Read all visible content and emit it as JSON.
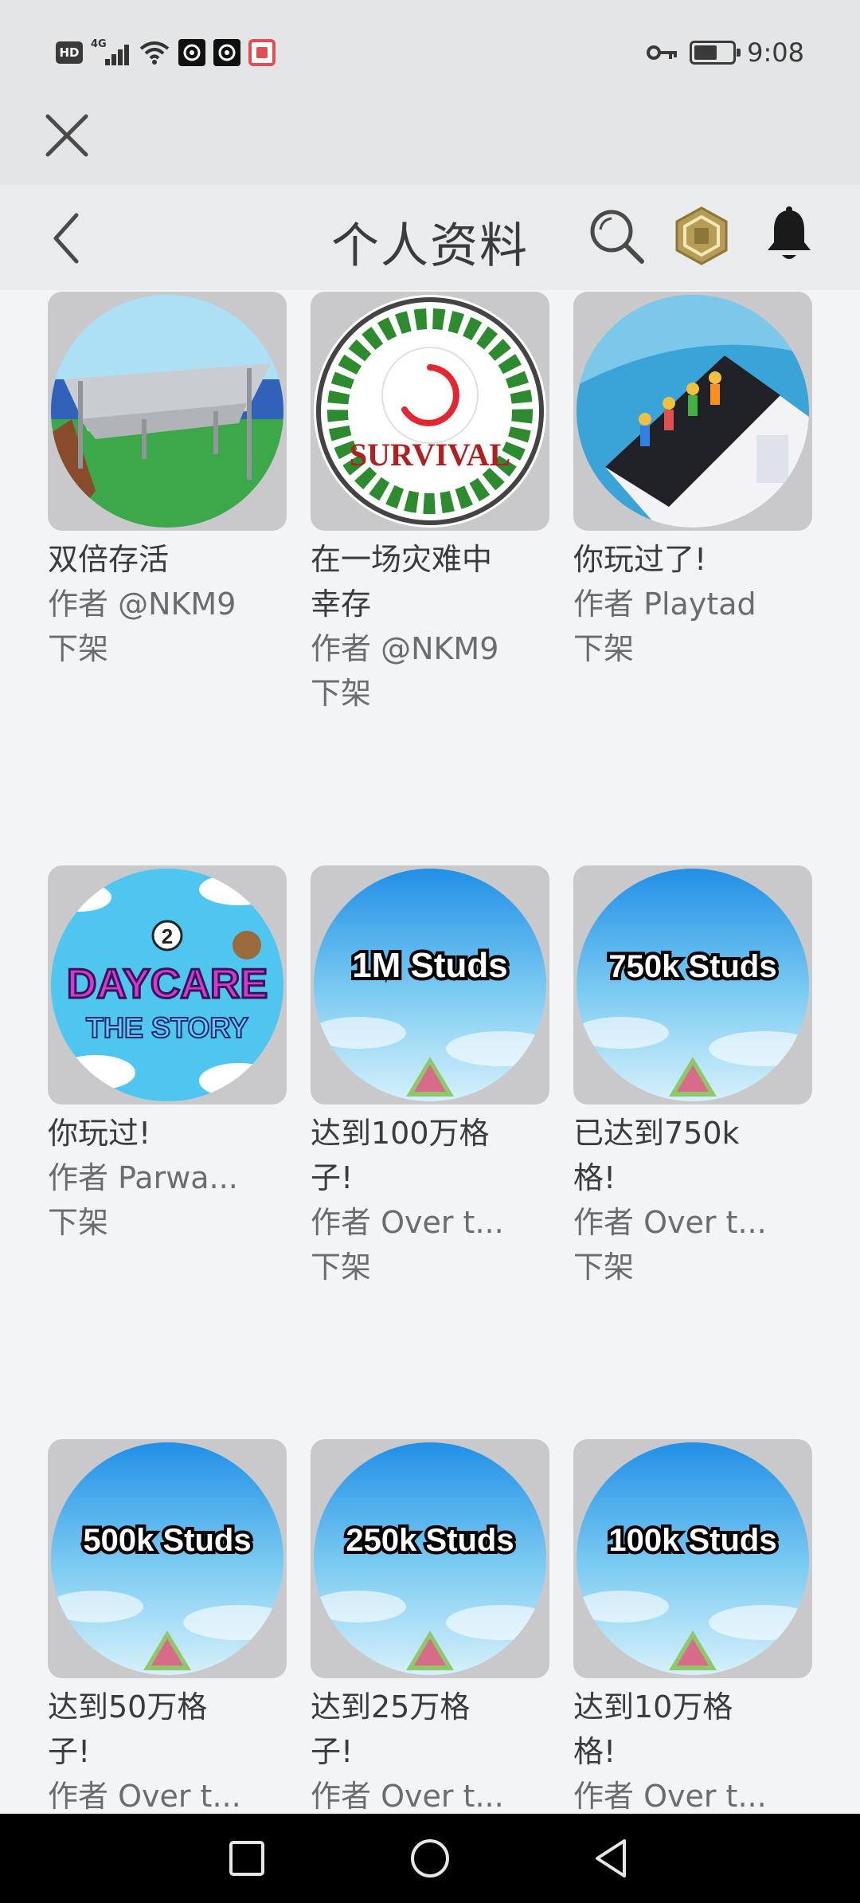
{
  "status_bar": {
    "hd_label": "HD",
    "network_label": "4G",
    "time": "9:08",
    "icons": [
      "hd-icon",
      "signal-icon",
      "wifi-icon",
      "app-icon",
      "app-icon",
      "app-icon",
      "key-icon",
      "battery-icon"
    ]
  },
  "header": {
    "title": "个人资料",
    "back_icon": "chevron-left-icon",
    "search_icon": "search-icon",
    "robux_icon": "robux-icon",
    "notification_icon": "bell-icon"
  },
  "close_icon": "close-icon",
  "badges": [
    {
      "title_lines": [
        "双倍存活"
      ],
      "creator": "作者 @NKM9",
      "status": "下架",
      "thumb": "platform"
    },
    {
      "title_lines": [
        "在一场灾难中",
        "幸存"
      ],
      "creator": "作者 @NKM9",
      "status": "下架",
      "thumb": "survival",
      "thumb_text": "SURVIVAL"
    },
    {
      "title_lines": [
        "你玩过了!"
      ],
      "creator": "作者 Playtad",
      "status": "下架",
      "thumb": "roof"
    },
    {
      "title_lines": [
        "你玩过!"
      ],
      "creator": "作者 Parwa...",
      "status": "下架",
      "thumb": "daycare",
      "thumb_text_1": "DAYCARE",
      "thumb_text_2": "THE STORY",
      "thumb_badge": "2"
    },
    {
      "title_lines": [
        "达到100万格",
        "子!"
      ],
      "creator": "作者 Over t...",
      "status": "下架",
      "thumb": "studs",
      "thumb_text": "1M Studs"
    },
    {
      "title_lines": [
        "已达到750k",
        "格!"
      ],
      "creator": "作者 Over t...",
      "status": "下架",
      "thumb": "studs",
      "thumb_text": "750k Studs"
    },
    {
      "title_lines": [
        "达到50万格",
        "子!"
      ],
      "creator": "作者 Over t...",
      "status": "",
      "thumb": "studs",
      "thumb_text": "500k Studs"
    },
    {
      "title_lines": [
        "达到25万格",
        "子!"
      ],
      "creator": "作者 Over t...",
      "status": "",
      "thumb": "studs",
      "thumb_text": "250k Studs"
    },
    {
      "title_lines": [
        "达到10万格",
        "格!"
      ],
      "creator": "作者 Over t...",
      "status": "",
      "thumb": "studs",
      "thumb_text": "100k Studs"
    }
  ],
  "nav_bar": {
    "icons": [
      "recents-square-icon",
      "home-circle-icon",
      "back-triangle-icon"
    ]
  },
  "colors": {
    "background": "#f2f4f5",
    "header": "#e9ebed",
    "status_bar": "#e3e5e7",
    "text_primary": "#393b3d",
    "text_secondary": "#6a6d70",
    "loading_spinner": "#e3262f"
  }
}
